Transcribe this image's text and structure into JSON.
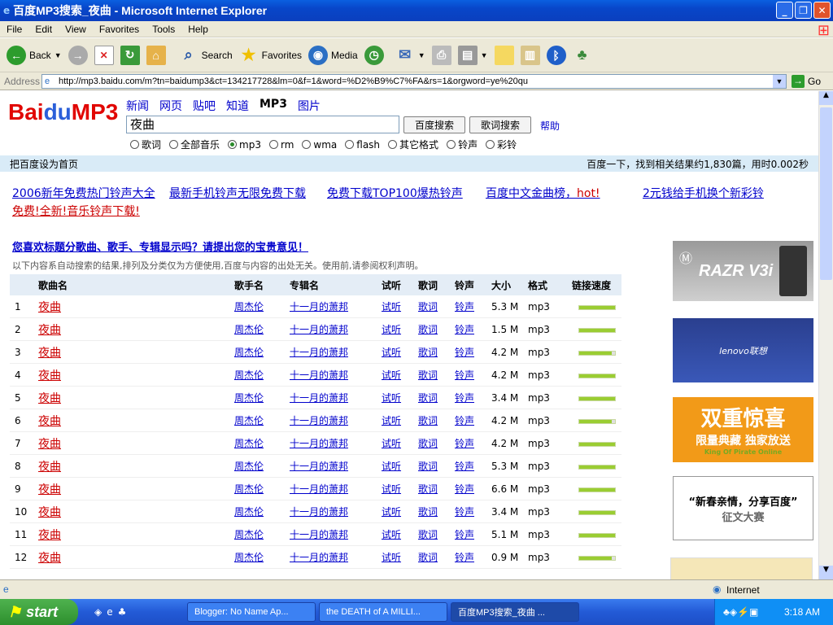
{
  "window": {
    "title": "百度MP3搜索_夜曲 - Microsoft Internet Explorer"
  },
  "menu": [
    "File",
    "Edit",
    "View",
    "Favorites",
    "Tools",
    "Help"
  ],
  "toolbar": {
    "back": "Back",
    "search": "Search",
    "favorites": "Favorites",
    "media": "Media"
  },
  "address": {
    "label": "Address",
    "url": "http://mp3.baidu.com/m?tn=baidump3&ct=134217728&lm=0&f=1&word=%D2%B9%C7%FA&rs=1&orgword=ye%20qu",
    "go": "Go"
  },
  "logo": "Bai du MP3",
  "nav": [
    "新闻",
    "网页",
    "贴吧",
    "知道",
    "MP3",
    "图片"
  ],
  "search": {
    "value": "夜曲",
    "btn1": "百度搜索",
    "btn2": "歌词搜索",
    "help": "帮助"
  },
  "formats": [
    {
      "label": "歌词",
      "on": false
    },
    {
      "label": "全部音乐",
      "on": false
    },
    {
      "label": "mp3",
      "on": true
    },
    {
      "label": "rm",
      "on": false
    },
    {
      "label": "wma",
      "on": false
    },
    {
      "label": "flash",
      "on": false
    },
    {
      "label": "其它格式",
      "on": false
    },
    {
      "label": "铃声",
      "on": false
    },
    {
      "label": "彩铃",
      "on": false
    }
  ],
  "bluebar": {
    "left": "把百度设为首页",
    "right": "百度一下，找到相关结果约1,830篇，用时0.002秒"
  },
  "promos": [
    "2006新年免费热门铃声大全",
    "最新手机铃声无限免费下载",
    "免费下载TOP100爆热铃声",
    "百度中文金曲榜，",
    "hot!",
    "2元钱给手机换个新彩铃",
    "免费!全新!音乐铃声下载!"
  ],
  "feedback": "您喜欢标题分歌曲、歌手、专辑显示吗？请提出您的宝贵意见！",
  "notice": "以下内容系自动搜索的结果,排列及分类仅为方便使用,百度与内容的出处无关。使用前,请参阅权利声明。",
  "headers": [
    "歌曲名",
    "歌手名",
    "专辑名",
    "试听",
    "歌词",
    "铃声",
    "大小",
    "格式",
    "链接速度"
  ],
  "rows": [
    {
      "n": "1",
      "song": "夜曲",
      "artist": "周杰伦",
      "album": "十一月的萧邦",
      "listen": "试听",
      "lyrics": "歌词",
      "ring": "铃声",
      "size": "5.3 M",
      "fmt": "mp3",
      "speed": 1.0
    },
    {
      "n": "2",
      "song": "夜曲",
      "artist": "周杰伦",
      "album": "十一月的萧邦",
      "listen": "试听",
      "lyrics": "歌词",
      "ring": "铃声",
      "size": "1.5 M",
      "fmt": "mp3",
      "speed": 1.0
    },
    {
      "n": "3",
      "song": "夜曲",
      "artist": "周杰伦",
      "album": "十一月的萧邦",
      "listen": "试听",
      "lyrics": "歌词",
      "ring": "铃声",
      "size": "4.2 M",
      "fmt": "mp3",
      "speed": 0.9
    },
    {
      "n": "4",
      "song": "夜曲",
      "artist": "周杰伦",
      "album": "十一月的萧邦",
      "listen": "试听",
      "lyrics": "歌词",
      "ring": "铃声",
      "size": "4.2 M",
      "fmt": "mp3",
      "speed": 1.0
    },
    {
      "n": "5",
      "song": "夜曲",
      "artist": "周杰伦",
      "album": "十一月的萧邦",
      "listen": "试听",
      "lyrics": "歌词",
      "ring": "铃声",
      "size": "3.4 M",
      "fmt": "mp3",
      "speed": 1.0
    },
    {
      "n": "6",
      "song": "夜曲",
      "artist": "周杰伦",
      "album": "十一月的萧邦",
      "listen": "试听",
      "lyrics": "歌词",
      "ring": "铃声",
      "size": "4.2 M",
      "fmt": "mp3",
      "speed": 0.9
    },
    {
      "n": "7",
      "song": "夜曲",
      "artist": "周杰伦",
      "album": "十一月的萧邦",
      "listen": "试听",
      "lyrics": "歌词",
      "ring": "铃声",
      "size": "4.2 M",
      "fmt": "mp3",
      "speed": 1.0
    },
    {
      "n": "8",
      "song": "夜曲",
      "artist": "周杰伦",
      "album": "十一月的萧邦",
      "listen": "试听",
      "lyrics": "歌词",
      "ring": "铃声",
      "size": "5.3 M",
      "fmt": "mp3",
      "speed": 1.0
    },
    {
      "n": "9",
      "song": "夜曲",
      "artist": "周杰伦",
      "album": "十一月的萧邦",
      "listen": "试听",
      "lyrics": "歌词",
      "ring": "铃声",
      "size": "6.6 M",
      "fmt": "mp3",
      "speed": 1.0
    },
    {
      "n": "10",
      "song": "夜曲",
      "artist": "周杰伦",
      "album": "十一月的萧邦",
      "listen": "试听",
      "lyrics": "歌词",
      "ring": "铃声",
      "size": "3.4 M",
      "fmt": "mp3",
      "speed": 1.0
    },
    {
      "n": "11",
      "song": "夜曲",
      "artist": "周杰伦",
      "album": "十一月的萧邦",
      "listen": "试听",
      "lyrics": "歌词",
      "ring": "铃声",
      "size": "5.1 M",
      "fmt": "mp3",
      "speed": 1.0
    },
    {
      "n": "12",
      "song": "夜曲",
      "artist": "周杰伦",
      "album": "十一月的萧邦",
      "listen": "试听",
      "lyrics": "歌词",
      "ring": "铃声",
      "size": "0.9 M",
      "fmt": "mp3",
      "speed": 0.9
    }
  ],
  "ads": {
    "razr": "RAZR V3i",
    "lenovo": "lenovo联想",
    "pirate1": "双重惊喜",
    "pirate2": "限量典藏 独家放送",
    "pirate3": "King Of Pirate Online",
    "spring1": "“新春亲情，分享百度”",
    "spring2": "征文大赛"
  },
  "status": {
    "zone": "Internet"
  },
  "taskbar": {
    "start": "start",
    "tasks": [
      "Blogger: No Name Ap...",
      "the DEATH of A MILLI...",
      "百度MP3搜索_夜曲 ..."
    ],
    "time": "3:18 AM"
  },
  "colors": {
    "accent": "#0000cc",
    "red": "#cc0000",
    "blue_bar": "#d9ebf7"
  }
}
